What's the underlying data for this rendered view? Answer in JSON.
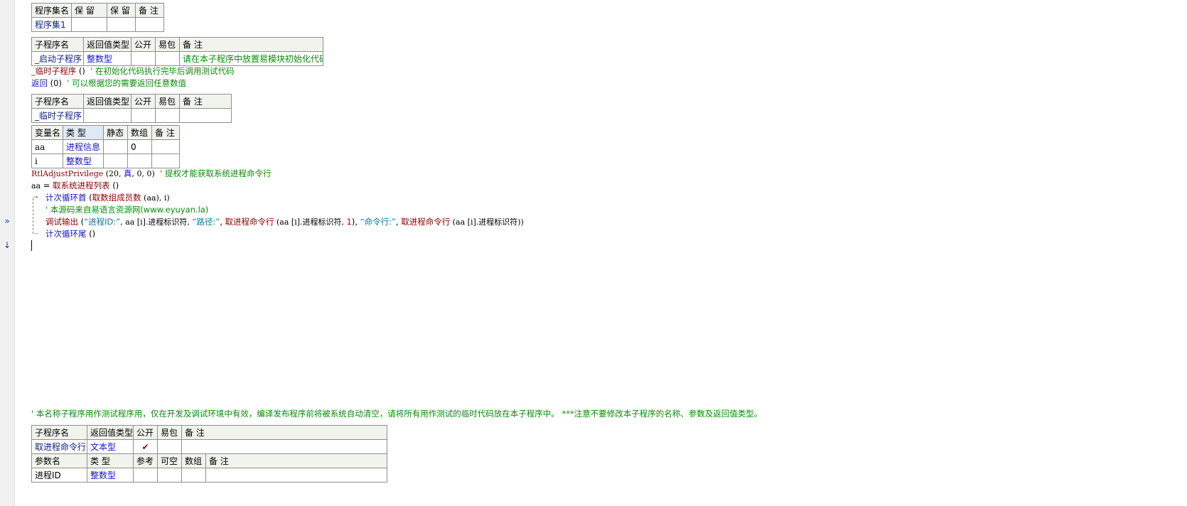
{
  "gutter": {
    "exec_marker": "»",
    "cursor_marker": "↓"
  },
  "assembly_table": {
    "headers": [
      "程序集名",
      "保 留",
      "保 留",
      "备 注"
    ],
    "row": [
      "程序集1",
      "",
      "",
      ""
    ]
  },
  "startup_sub_table": {
    "headers": [
      "子程序名",
      "返回值类型",
      "公开",
      "易包",
      "备 注"
    ],
    "row": [
      "_启动子程序",
      "整数型",
      "",
      "",
      "请在本子程序中放置易模块初始化代码"
    ]
  },
  "startup_code": [
    {
      "call": "_临时子程序",
      "args": " ()",
      "comment": "' 在初始化代码执行完毕后调用测试代码"
    },
    {
      "call": "返回",
      "args": " (0)",
      "comment": "' 可以根据您的需要返回任意数值"
    }
  ],
  "temp_sub_table": {
    "headers": [
      "子程序名",
      "返回值类型",
      "公开",
      "易包",
      "备 注"
    ],
    "row": [
      "_临时子程序",
      "",
      "",
      "",
      ""
    ]
  },
  "var_table": {
    "headers": [
      "变量名",
      "类 型",
      "静态",
      "数组",
      "备 注"
    ],
    "rows": [
      [
        "aa",
        "进程信息",
        "",
        "0",
        ""
      ],
      [
        "i",
        "整数型",
        "",
        "",
        ""
      ]
    ]
  },
  "code": {
    "line1": {
      "fn": "RtlAdjustPrivilege",
      "args": " (20, ",
      "true_kw": "真",
      "args2": ", 0, 0)",
      "comment": "' 提权才能获取系统进程命令行"
    },
    "line2": {
      "lhs": "aa",
      "op": " = ",
      "fn": "取系统进程列表",
      "args": " ()"
    },
    "line3": {
      "kw": "计次循环首",
      "open": " (",
      "fn": "取数组成员数",
      "args": " (aa), i)"
    },
    "line4": {
      "comment": "' 本源码来自易语言资源网(www.eyuyan.la)"
    },
    "line5": {
      "fn": "调试输出",
      "p1": " (",
      "s1": "“进程ID:”",
      "p2": ", aa [i].进程标识符, ",
      "s2": "“路径:”",
      "p3": ", ",
      "fn2": "取进程命令行",
      "p4": " (aa [i].进程标识符, ",
      "n1": "1",
      "p5": "), ",
      "s3": "“命令行:”",
      "p6": ", ",
      "fn3": "取进程命令行",
      "p7": " (aa [i].进程标识符))"
    },
    "line6": {
      "kw": "计次循环尾",
      "args": " ()"
    }
  },
  "bottom_comment": "' 本名称子程序用作测试程序用，仅在开发及调试环境中有效，编译发布程序前将被系统自动清空，请将所有用作测试的临时代码放在本子程序中。 ***注意不要修改本子程序的名称、参数及返回值类型。",
  "cmdline_sub_table": {
    "headers": [
      "子程序名",
      "返回值类型",
      "公开",
      "易包",
      "备 注"
    ],
    "row": [
      "取进程命令行",
      "文本型",
      "✔",
      "",
      ""
    ]
  },
  "param_table": {
    "headers": [
      "参数名",
      "类 型",
      "参考",
      "可空",
      "数组",
      "备 注"
    ],
    "row": [
      "进程ID",
      "整数型",
      "",
      "",
      "",
      ""
    ]
  }
}
